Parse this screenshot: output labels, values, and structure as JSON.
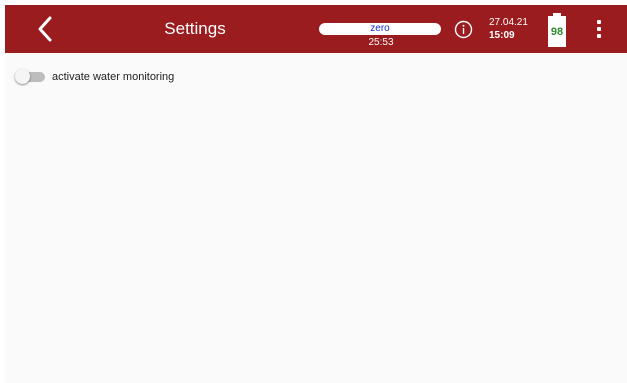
{
  "header": {
    "title": "Settings",
    "background_color": "#9b1c1f",
    "back_icon": "chevron-left-icon",
    "status_pill_label": "zero",
    "timer": "25:53",
    "info_icon": "info-circle-icon",
    "date": "27.04.21",
    "time": "15:09",
    "battery_level": "98",
    "battery_text_color": "#2e8b2e",
    "menu_icon": "more-vertical-icon"
  },
  "settings": {
    "water_monitoring": {
      "label": "activate water monitoring",
      "enabled": false
    }
  }
}
